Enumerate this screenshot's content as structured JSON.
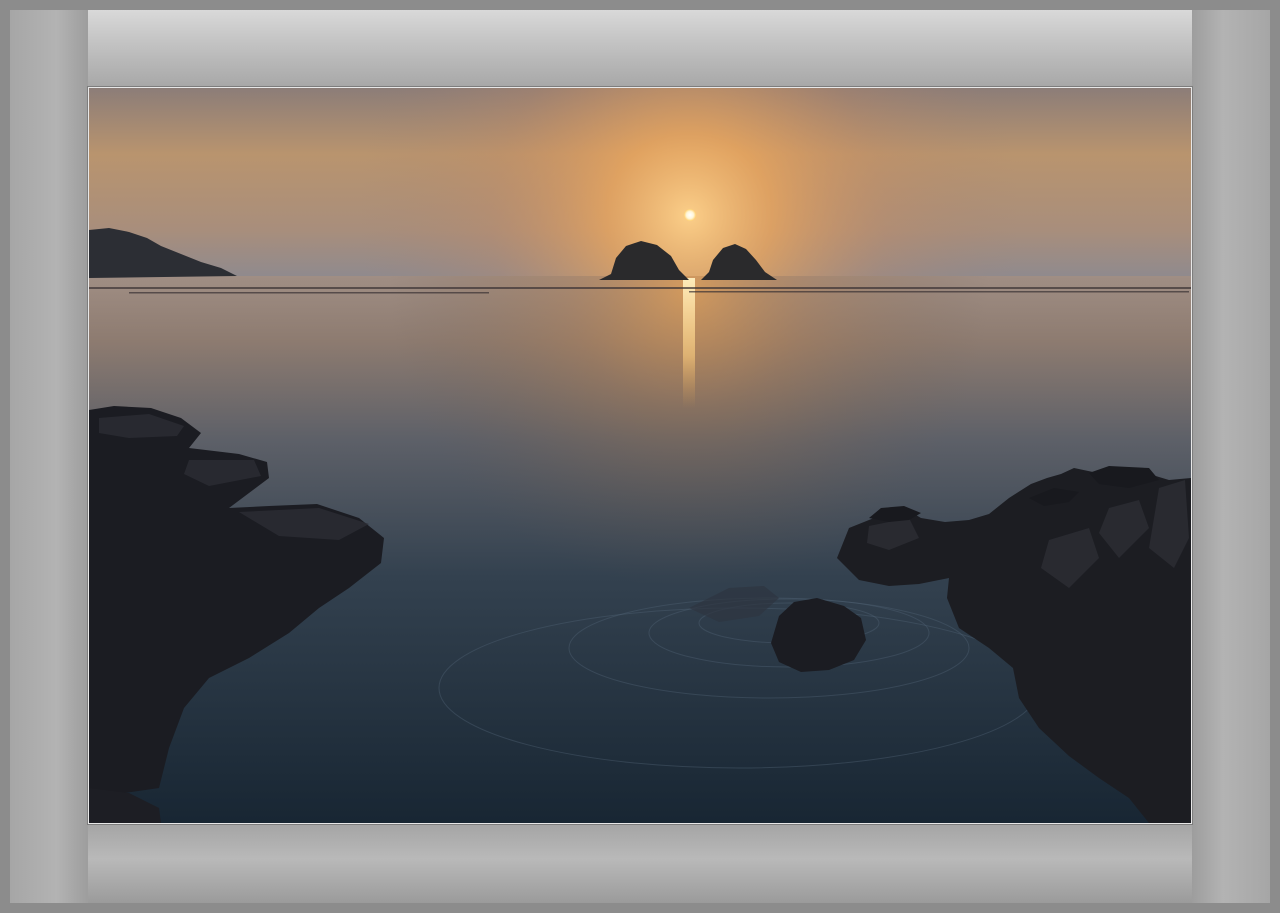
{
  "scene": {
    "subject": "sunset-over-sea",
    "colors": {
      "sky_top": "#8a7a78",
      "sky_glow": "#f0b060",
      "sun": "#fff4d0",
      "sea_near": "#1d2d3a",
      "rocks": "#1a1a1e",
      "frame": "#8c8c8c",
      "mat": "#bdbdbd"
    }
  }
}
